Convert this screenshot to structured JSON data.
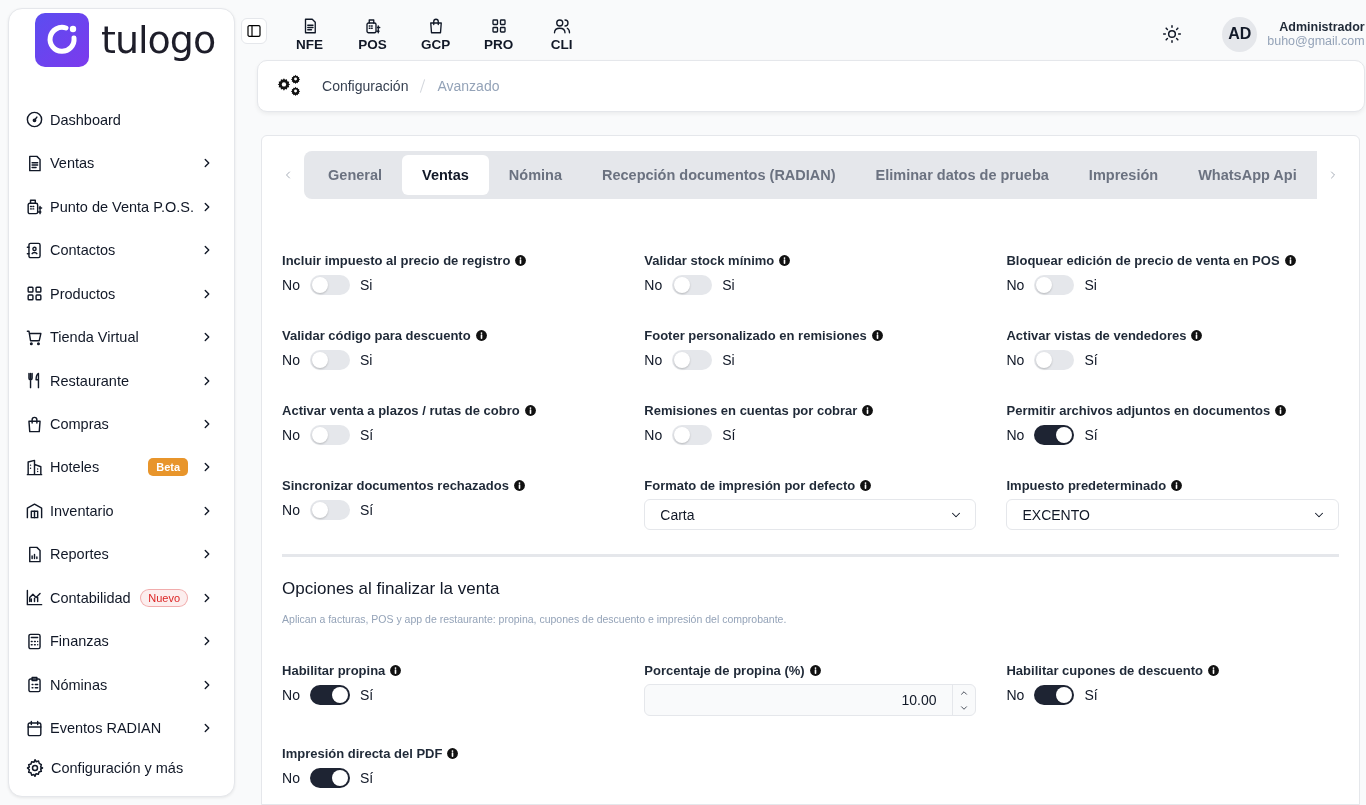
{
  "logo": {
    "text": "tulogo"
  },
  "sidebar": {
    "items": [
      {
        "label": "Dashboard",
        "submenu": false
      },
      {
        "label": "Ventas",
        "submenu": true
      },
      {
        "label": "Punto de Venta P.O.S.",
        "submenu": true
      },
      {
        "label": "Contactos",
        "submenu": true
      },
      {
        "label": "Productos",
        "submenu": true
      },
      {
        "label": "Tienda Virtual",
        "submenu": true
      },
      {
        "label": "Restaurante",
        "submenu": true
      },
      {
        "label": "Compras",
        "submenu": true
      },
      {
        "label": "Hoteles",
        "submenu": true,
        "badge": {
          "text": "Beta",
          "kind": "solid",
          "color": "#e8952b"
        }
      },
      {
        "label": "Inventario",
        "submenu": true
      },
      {
        "label": "Reportes",
        "submenu": true
      },
      {
        "label": "Contabilidad",
        "submenu": true,
        "badge": {
          "text": "Nuevo",
          "kind": "soft",
          "color": "#dc2626"
        }
      },
      {
        "label": "Finanzas",
        "submenu": true
      },
      {
        "label": "Nóminas",
        "submenu": true
      },
      {
        "label": "Eventos RADIAN",
        "submenu": true
      }
    ],
    "footer": "Configuración y más"
  },
  "shortcuts": [
    "NFE",
    "POS",
    "GCP",
    "PRO",
    "CLI"
  ],
  "user": {
    "initials": "AD",
    "name": "Administrador",
    "email": "buho@gmail.com"
  },
  "breadcrumb": [
    "Configuración",
    "Avanzado"
  ],
  "tabs": [
    {
      "label": "General",
      "selected": false
    },
    {
      "label": "Ventas",
      "selected": true
    },
    {
      "label": "Nómina",
      "selected": false
    },
    {
      "label": "Recepción documentos (RADIAN)",
      "selected": false
    },
    {
      "label": "Eliminar datos de prueba",
      "selected": false
    },
    {
      "label": "Impresión",
      "selected": false
    },
    {
      "label": "WhatsApp Api",
      "selected": false
    }
  ],
  "settings": [
    {
      "kind": "toggle",
      "label": "Incluir impuesto al precio de registro",
      "off": "No",
      "on_label": "Si",
      "on": false
    },
    {
      "kind": "toggle",
      "label": "Validar stock mínimo",
      "off": "No",
      "on_label": "Si",
      "on": false
    },
    {
      "kind": "toggle",
      "label": "Bloquear edición de precio de venta en POS",
      "off": "No",
      "on_label": "Si",
      "on": false
    },
    {
      "kind": "toggle",
      "label": "Validar código para descuento",
      "off": "No",
      "on_label": "Si",
      "on": false
    },
    {
      "kind": "toggle",
      "label": "Footer personalizado en remisiones",
      "off": "No",
      "on_label": "Si",
      "on": false
    },
    {
      "kind": "toggle",
      "label": "Activar vistas de vendedores",
      "off": "No",
      "on_label": "Sí",
      "on": false
    },
    {
      "kind": "toggle",
      "label": "Activar venta a plazos / rutas de cobro",
      "off": "No",
      "on_label": "Sí",
      "on": false
    },
    {
      "kind": "toggle",
      "label": "Remisiones en cuentas por cobrar",
      "off": "No",
      "on_label": "Sí",
      "on": false
    },
    {
      "kind": "toggle",
      "label": "Permitir archivos adjuntos en documentos",
      "off": "No",
      "on_label": "Sí",
      "on": true
    },
    {
      "kind": "toggle",
      "label": "Sincronizar documentos rechazados",
      "off": "No",
      "on_label": "Sí",
      "on": false
    },
    {
      "kind": "select",
      "label": "Formato de impresión por defecto",
      "value": "Carta"
    },
    {
      "kind": "select",
      "label": "Impuesto predeterminado",
      "value": "EXCENTO"
    }
  ],
  "finish": {
    "title": "Opciones al finalizar la venta",
    "note": "Aplican a facturas, POS y app de restaurante: propina, cupones de descuento e impresión del comprobante.",
    "settings": [
      {
        "kind": "toggle",
        "label": "Habilitar propina",
        "off": "No",
        "on_label": "Sí",
        "on": true
      },
      {
        "kind": "number",
        "label": "Porcentaje de propina (%)",
        "value": "10.00"
      },
      {
        "kind": "toggle",
        "label": "Habilitar cupones de descuento",
        "off": "No",
        "on_label": "Sí",
        "on": true
      },
      {
        "kind": "toggle",
        "label": "Impresión directa del PDF",
        "off": "No",
        "on_label": "Sí",
        "on": true
      }
    ]
  }
}
